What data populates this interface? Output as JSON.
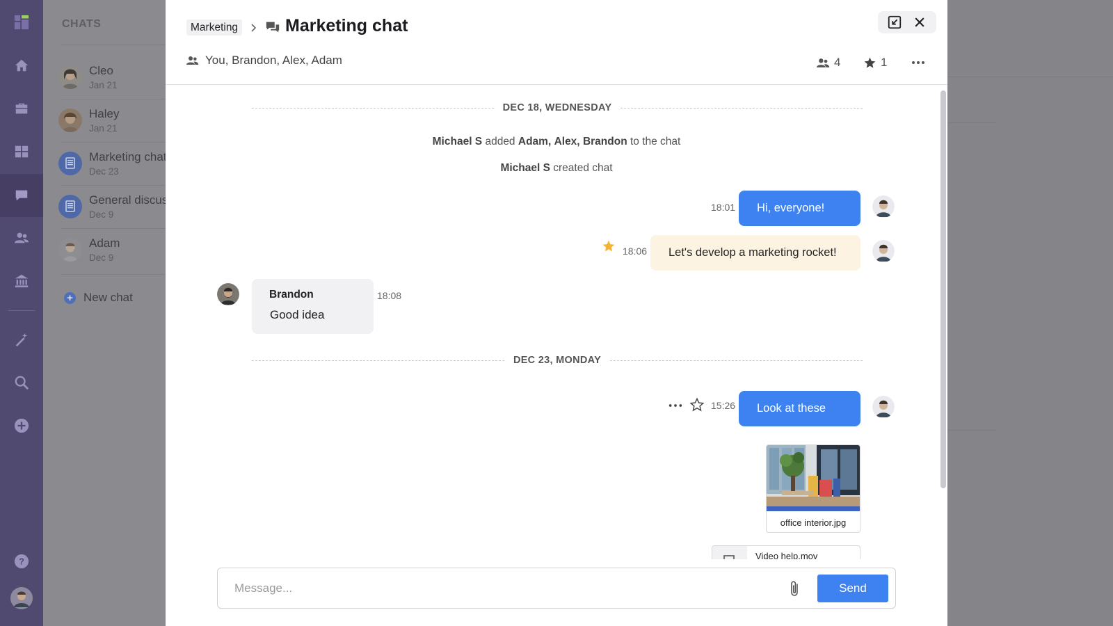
{
  "nav": {
    "items": [
      {
        "name": "logo-icon"
      },
      {
        "name": "home-icon"
      },
      {
        "name": "briefcase-icon"
      },
      {
        "name": "dashboard-icon"
      },
      {
        "name": "chat-icon",
        "active": true
      },
      {
        "name": "people-icon"
      },
      {
        "name": "bank-icon"
      },
      {
        "name": "magic-wand-icon"
      },
      {
        "name": "search-icon"
      },
      {
        "name": "add-icon"
      },
      {
        "name": "help-icon"
      },
      {
        "name": "user-avatar"
      }
    ]
  },
  "chat_list": {
    "heading": "CHATS",
    "items": [
      {
        "name": "Cleo",
        "date": "Jan 21"
      },
      {
        "name": "Haley",
        "date": "Jan 21"
      },
      {
        "name": "Marketing chat",
        "date": "Dec 23"
      },
      {
        "name": "General discussion",
        "date": "Dec 9"
      },
      {
        "name": "Adam",
        "date": "Dec 9"
      }
    ],
    "new_chat": "New chat"
  },
  "header": {
    "breadcrumb": "Marketing",
    "title": "Marketing chat",
    "members": "You, Brandon, Alex, Adam",
    "member_count": "4",
    "starred_count": "1"
  },
  "feed": {
    "day1": "DEC 18, WEDNESDAY",
    "sys1": {
      "actor": "Michael S",
      "verb": "added",
      "targets": [
        "Adam,",
        "Alex,",
        "Brandon"
      ],
      "tail": "to the chat"
    },
    "sys2": {
      "actor": "Michael S",
      "tail": "created chat"
    },
    "m1": {
      "time": "18:01",
      "text": "Hi, everyone!"
    },
    "m2": {
      "time": "18:06",
      "text": "Let's develop a marketing rocket!",
      "starred": true
    },
    "m3": {
      "author": "Brandon",
      "time": "18:08",
      "text": "Good idea"
    },
    "day2": "DEC 23, MONDAY",
    "m4": {
      "time": "15:26",
      "text": "Look at these"
    },
    "attachments": [
      {
        "filename": "office interior.jpg",
        "type": "image"
      },
      {
        "filename": "Video help.mov",
        "type": "video"
      }
    ]
  },
  "composer": {
    "placeholder": "Message...",
    "send_label": "Send"
  },
  "colors": {
    "accent": "#3d82f0",
    "nav": "#504a70",
    "star": "#f5b335",
    "highlight_bubble": "#fdf3e3"
  }
}
